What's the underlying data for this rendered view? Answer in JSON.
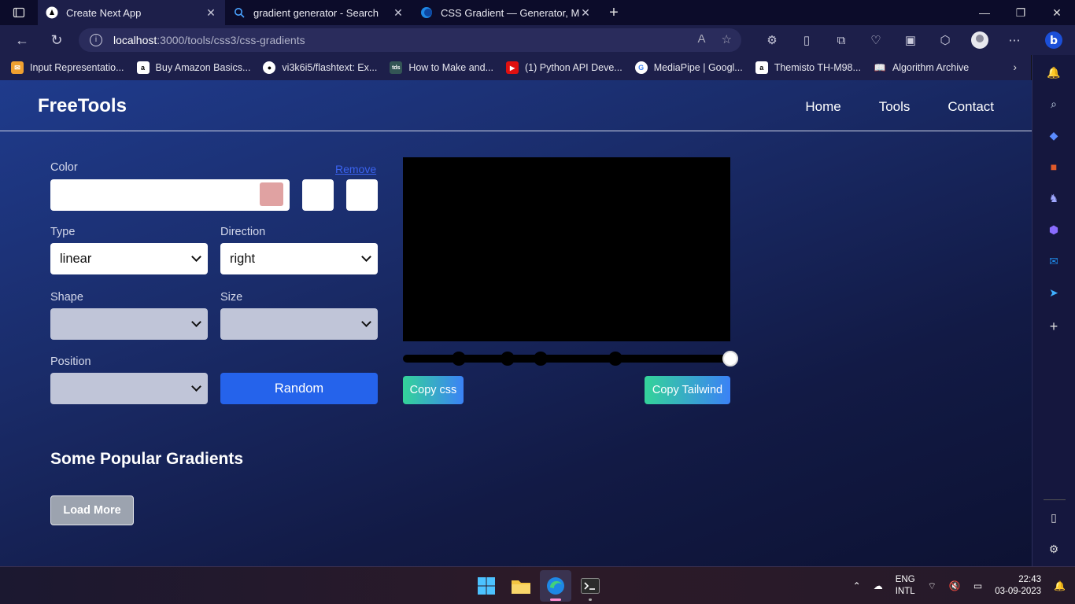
{
  "browser": {
    "tabs": [
      {
        "title": "Create Next App",
        "active": true
      },
      {
        "title": "gradient generator - Search",
        "active": false
      },
      {
        "title": "CSS Gradient — Generator, Maker, and",
        "active": false
      }
    ],
    "address": {
      "host": "localhost",
      "path": ":3000/tools/css3/css-gradients"
    },
    "favorites": [
      {
        "label": "Input Representatio...",
        "icon": "bookmark-icon"
      },
      {
        "label": "Buy Amazon Basics...",
        "icon": "amazon-icon"
      },
      {
        "label": "vi3k6i5/flashtext: Ex...",
        "icon": "github-icon"
      },
      {
        "label": "How to Make and...",
        "icon": "tds-icon"
      },
      {
        "label": "(1) Python API Deve...",
        "icon": "youtube-icon"
      },
      {
        "label": "MediaPipe | Googl...",
        "icon": "google-icon"
      },
      {
        "label": "Themisto TH-M98...",
        "icon": "amazon-icon"
      },
      {
        "label": "Algorithm Archive",
        "icon": "book-icon"
      }
    ]
  },
  "site": {
    "logo": "FreeTools",
    "nav": [
      "Home",
      "Tools",
      "Contact"
    ]
  },
  "form": {
    "color_label": "Color",
    "remove_label": "Remove",
    "swatch_color": "#e0a2a2",
    "type_label": "Type",
    "type_value": "linear",
    "direction_label": "Direction",
    "direction_value": "right",
    "shape_label": "Shape",
    "shape_value": "",
    "size_label": "Size",
    "size_value": "",
    "position_label": "Position",
    "position_value": "",
    "random_label": "Random"
  },
  "preview": {
    "color": "#000000",
    "stops_fraction": [
      0.17,
      0.32,
      0.42,
      0.65,
      1.0
    ]
  },
  "actions": {
    "copy_css": "Copy css",
    "copy_tailwind": "Copy Tailwind"
  },
  "popular": {
    "heading": "Some Popular Gradients",
    "load_more": "Load More"
  },
  "taskbar": {
    "lang1": "ENG",
    "lang2": "INTL",
    "time": "22:43",
    "date": "03-09-2023"
  },
  "colors": {
    "accent": "#2563eb",
    "link": "#3b63f0"
  }
}
